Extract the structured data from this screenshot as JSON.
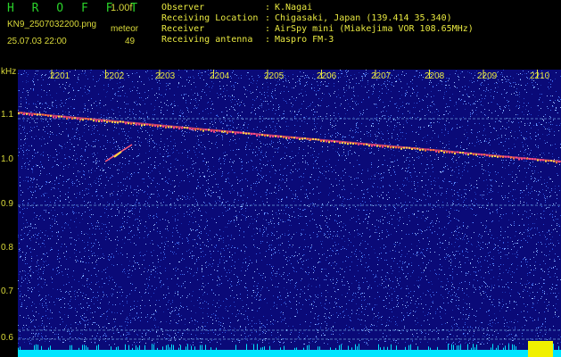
{
  "header": {
    "brand": "H R O F F T",
    "version": "1.00f",
    "filename": "KN9_2507032200.png",
    "datetime": "25.07.03 22:00",
    "mode": "meteor",
    "count": "49",
    "fields": [
      {
        "key": "Observer",
        "sep": ":",
        "value": "K.Nagai"
      },
      {
        "key": "Receiving Location",
        "sep": ":",
        "value": "Chigasaki, Japan (139.414 35.340)"
      },
      {
        "key": "Receiver",
        "sep": ":",
        "value": "AirSpy mini (Miakejima VOR 108.65MHz)"
      },
      {
        "key": "Receiving antenna",
        "sep": ":",
        "value": "Maspro FM-3"
      }
    ]
  },
  "spectrogram": {
    "yunit": "kHz",
    "ylabels": [
      "1.1",
      "1.0",
      "0.9",
      "0.8",
      "0.7",
      "0.6"
    ],
    "xlabels": [
      "2201",
      "2202",
      "2203",
      "2204",
      "2205",
      "2206",
      "2207",
      "2208",
      "2209",
      "2210"
    ],
    "colors": {
      "background": "#0a0a78",
      "noise": "#4a8cff",
      "trace": "#e04a6a",
      "baseline": "#00e5ff",
      "burst": "#f0f000"
    }
  }
}
